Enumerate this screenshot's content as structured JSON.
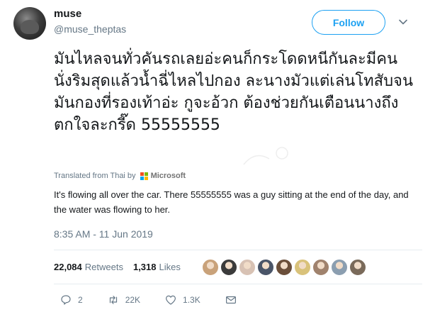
{
  "author": {
    "name": "muse",
    "handle": "@muse_theptas"
  },
  "follow_label": "Follow",
  "tweet_text": "มันไหลจนทั่วคันรถเลยอ่ะคนก็กระโดดหนีกันละมีคนนั่งริมสุดแล้วน้ำฉี่ไหลไปกอง ละนางมัวแต่เล่นโทสับจนมันกองที่รองเท้าอ่ะ กูจะอ้วก ต้องช่วยกันเตือนนางถึงตกใจละกรี๊ด 55555555",
  "translation_attribution": {
    "label": "Translated from Thai by",
    "provider": "Microsoft"
  },
  "translation_text": "It's flowing all over the car. There 55555555 was a guy sitting at the end of the day, and the water was flowing to her.",
  "timestamp": "8:35 AM - 11 Jun 2019",
  "stats": {
    "retweets_count": "22,084",
    "retweets_label": "Retweets",
    "likes_count": "1,318",
    "likes_label": "Likes"
  },
  "actions": {
    "replies": "2",
    "retweets": "22K",
    "likes": "1.3K"
  },
  "colors": {
    "accent": "#1da1f2",
    "text": "#14171a",
    "muted": "#657786"
  },
  "liker_avatar_colors": [
    "#c9a27a",
    "#3b3b3b",
    "#d8c2b4",
    "#4a5568",
    "#6b4f3a",
    "#d9c27a",
    "#a0826d",
    "#8b9eb0",
    "#7a6a5a"
  ]
}
